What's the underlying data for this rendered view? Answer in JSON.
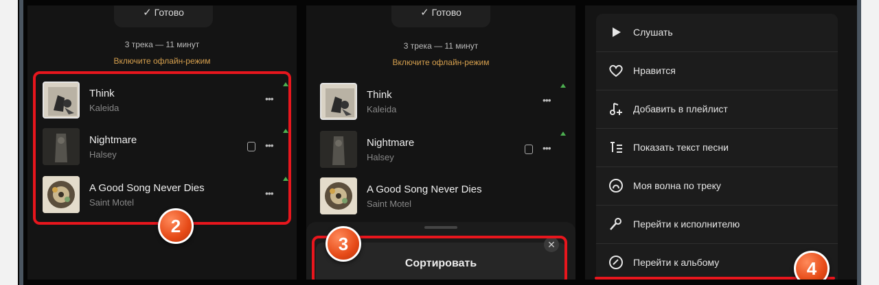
{
  "colors": {
    "highlight": "#e8161d",
    "offline": "#d6a04e",
    "badge": "#e64a17",
    "download": "#4caf50"
  },
  "library": {
    "done_label": "Готово",
    "summary": "3 трека — 11 минут",
    "offline_link": "Включите офлайн-режим",
    "tracks": [
      {
        "title": "Think",
        "artist": "Kaleida",
        "more_icon": "more-dots-icon",
        "downloaded": true
      },
      {
        "title": "Nightmare",
        "artist": "Halsey",
        "more_icon": "more-dots-icon",
        "downloaded": true,
        "has_lyrics": true
      },
      {
        "title": "A Good Song Never Dies",
        "artist": "Saint Motel",
        "more_icon": "more-dots-icon",
        "downloaded": true
      }
    ]
  },
  "sheet": {
    "sort_label": "Сортировать",
    "close_icon": "close-icon"
  },
  "context_menu": {
    "items": [
      {
        "label": "Слушать",
        "icon": "play-icon"
      },
      {
        "label": "Нравится",
        "icon": "heart-icon"
      },
      {
        "label": "Добавить в плейлист",
        "icon": "add-to-playlist-icon"
      },
      {
        "label": "Показать текст песни",
        "icon": "lyrics-icon"
      },
      {
        "label": "Моя волна по треку",
        "icon": "wave-icon"
      },
      {
        "label": "Перейти к исполнителю",
        "icon": "microphone-icon"
      },
      {
        "label": "Перейти к альбому",
        "icon": "album-icon"
      }
    ]
  },
  "steps": {
    "step2": "2",
    "step3": "3",
    "step4": "4"
  }
}
